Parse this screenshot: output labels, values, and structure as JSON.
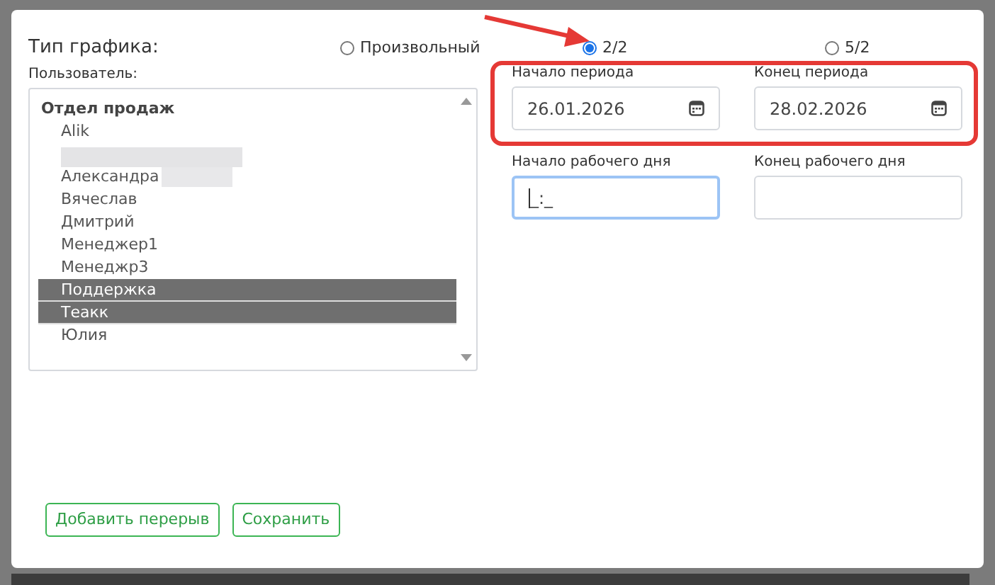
{
  "schedule_type": {
    "label": "Тип графика:",
    "options": [
      {
        "label": "Произвольный",
        "selected": false
      },
      {
        "label": "2/2",
        "selected": true
      },
      {
        "label": "5/2",
        "selected": false
      }
    ]
  },
  "user": {
    "label": "Пользователь:",
    "groups": [
      {
        "label": "Отдел продаж",
        "children": [
          {
            "label": "Alik",
            "selected": false
          },
          {
            "kind": "redacted",
            "selected": false
          },
          {
            "label": "Александра",
            "redacted_tail": true,
            "selected": false
          },
          {
            "label": "Вячеслав",
            "selected": false
          },
          {
            "label": "Дмитрий",
            "selected": false
          },
          {
            "label": "Менеджер1",
            "selected": false
          },
          {
            "label": "Менеджр3",
            "selected": false
          },
          {
            "label": "Поддержка",
            "selected": true
          },
          {
            "label": "Теакк",
            "selected": true
          },
          {
            "label": "Юлия",
            "selected": false
          }
        ]
      }
    ]
  },
  "period": {
    "start": {
      "label": "Начало периода",
      "value": "26.01.2026"
    },
    "end": {
      "label": "Конец периода",
      "value": "28.02.2026"
    }
  },
  "workday": {
    "start": {
      "label": "Начало рабочего дня",
      "value": "_:_",
      "focused": true
    },
    "end": {
      "label": "Конец рабочего дня",
      "focused": false
    }
  },
  "buttons": [
    "Добавить перерыв",
    "Сохранить"
  ]
}
